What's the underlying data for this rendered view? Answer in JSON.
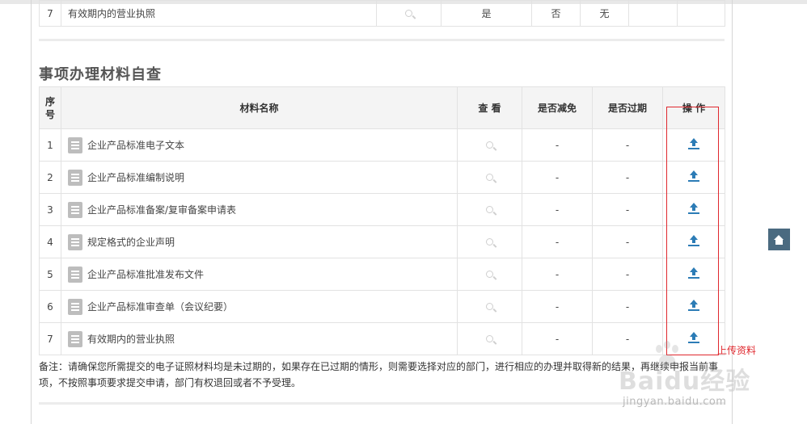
{
  "top_row": {
    "index": "7",
    "name": "有效期内的营业执照",
    "is_exempt": "是",
    "is_expired": "否",
    "remark": "无"
  },
  "section_title": "事项办理材料自查",
  "table": {
    "headers": {
      "index": "序号",
      "name": "材料名称",
      "view": "查 看",
      "is_exempt": "是否减免",
      "is_expired": "是否过期",
      "action": "操 作"
    },
    "rows": [
      {
        "index": "1",
        "name": "企业产品标准电子文本",
        "is_exempt": "-",
        "is_expired": "-"
      },
      {
        "index": "2",
        "name": "企业产品标准编制说明",
        "is_exempt": "-",
        "is_expired": "-"
      },
      {
        "index": "3",
        "name": "企业产品标准备案/复审备案申请表",
        "is_exempt": "-",
        "is_expired": "-"
      },
      {
        "index": "4",
        "name": "规定格式的企业声明",
        "is_exempt": "-",
        "is_expired": "-"
      },
      {
        "index": "5",
        "name": "企业产品标准批准发布文件",
        "is_exempt": "-",
        "is_expired": "-"
      },
      {
        "index": "6",
        "name": "企业产品标准审查单（会议纪要）",
        "is_exempt": "-",
        "is_expired": "-"
      },
      {
        "index": "7",
        "name": "有效期内的营业执照",
        "is_exempt": "-",
        "is_expired": "-"
      }
    ]
  },
  "note": "备注：请确保您所需提交的电子证照材料均是未过期的，如果存在已过期的情形，则需要选择对应的部门，进行相应的办理并取得新的结果，再继续申报当前事项，不按照事项要求提交申请，部门有权退回或者不予受理。",
  "annotation": "上传资料",
  "watermark": {
    "brand": "Baidu经验",
    "url": "jingyan.baidu.com"
  },
  "icons": {
    "doc": "document-icon",
    "view": "search-icon",
    "upload": "upload-icon",
    "back_to_top": "home-icon"
  },
  "colors": {
    "upload": "#2c7cb6",
    "highlight": "#e0282e",
    "back_to_top_bg": "#4a6a80",
    "header_bg": "#f4f4f4"
  }
}
